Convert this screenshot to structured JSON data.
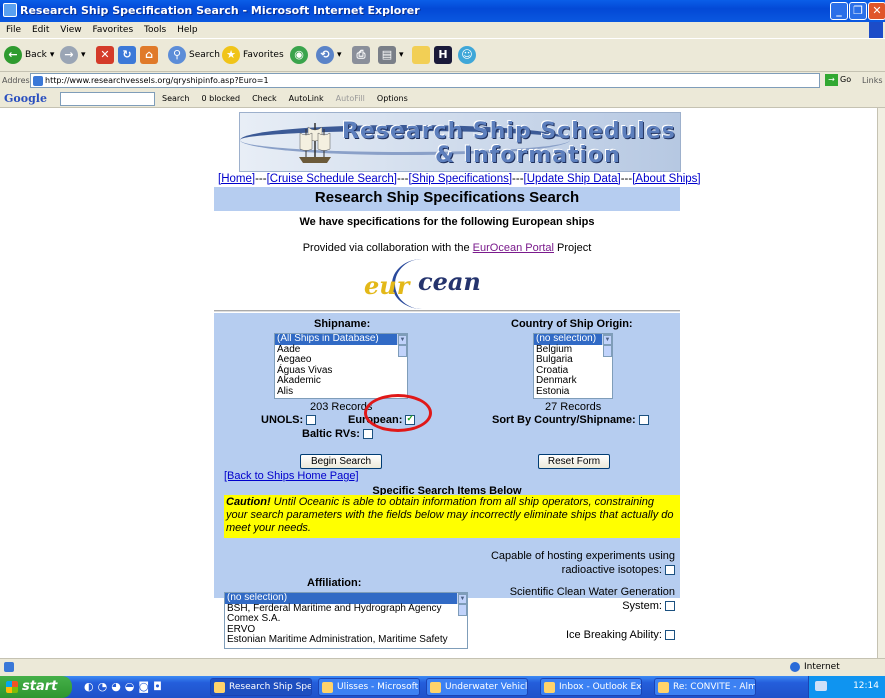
{
  "window": {
    "title": "Research Ship Specification Search - Microsoft Internet Explorer"
  },
  "menu": [
    "File",
    "Edit",
    "View",
    "Favorites",
    "Tools",
    "Help"
  ],
  "toolbar": {
    "back": "Back",
    "search": "Search",
    "favorites": "Favorites"
  },
  "address": {
    "label": "Address",
    "url": "http://www.researchvessels.org/qryshipinfo.asp?Euro=1",
    "go": "Go",
    "links": "Links"
  },
  "google": {
    "logo": "Google",
    "items": [
      "Search",
      "0 blocked",
      "Check",
      "AutoLink",
      "AutoFill",
      "Options"
    ]
  },
  "banner": {
    "line1": "Research Ship Schedules",
    "line2": "& Information"
  },
  "nav": {
    "home": "[Home]",
    "sep": "---",
    "cruise": "[Cruise Schedule Search]",
    "specs": "[Ship Specifications]",
    "update": "[Update Ship Data]",
    "about": "[About Ships]"
  },
  "page": {
    "heading": "Research Ship Specifications Search",
    "subtitle": "We have specifications for the following European ships",
    "collab_pre": "Provided via collaboration with the ",
    "collab_link": "EurOcean Portal",
    "collab_post": " Project",
    "logo_a": "eur",
    "logo_b": "cean"
  },
  "form": {
    "shipname_label": "Shipname:",
    "shipnames": [
      "(All Ships in Database)",
      "Aade",
      "Aegaeo",
      "Águas Vivas",
      "Akademic",
      "Alis"
    ],
    "ship_records": "203 Records",
    "country_label": "Country of Ship Origin:",
    "countries": [
      "(no selection)",
      "Belgium",
      "Bulgaria",
      "Croatia",
      "Denmark",
      "Estonia"
    ],
    "country_records": "27 Records",
    "unols": "UNOLS:",
    "european": "European:",
    "baltic": "Baltic RVs:",
    "sort": "Sort By Country/Shipname:",
    "begin": "Begin Search",
    "reset": "Reset Form"
  },
  "lower": {
    "back": "[Back to Ships Home Page]",
    "specific": "Specific Search Items Below",
    "caution_bold": "Caution!",
    "caution_text": " Until Oceanic is able to obtain information from all ship operators, constraining your search parameters with the fields below may incorrectly eliminate ships that actually do meet your needs.",
    "isotopes": "Capable of hosting experiments using radioactive isotopes:",
    "cleanwater": "Scientific Clean Water Generation System:",
    "icebreak": "Ice Breaking Ability:",
    "affiliation_label": "Affiliation:",
    "affiliations": [
      "(no selection)",
      "BSH, Ferderal Maritime and Hydrograph Agency",
      "Comex S.A.",
      "ERVO",
      "Estonian Maritime Administration, Maritime Safety"
    ]
  },
  "status": {
    "zone": "Internet"
  },
  "taskbar": {
    "start": "start",
    "tasks": [
      "Research Ship Specifi...",
      "Ulisses - Microsoft Int...",
      "Underwater Vehicles",
      "Inbox - Outlook Express",
      "Re: CONVITE - Almoç..."
    ],
    "clock": "12:14"
  }
}
